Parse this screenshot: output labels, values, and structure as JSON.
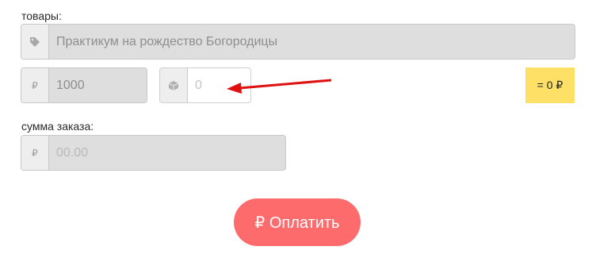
{
  "form": {
    "goods_label": "товары:",
    "product_value": "Практикум на рождество Богородицы",
    "price_icon": "₽",
    "price_value": "1000",
    "quantity_placeholder": "0",
    "total_text": "= 0 ₽",
    "order_sum_label": "сумма заказа:",
    "sum_icon": "₽",
    "sum_placeholder": "00.00",
    "pay_button_label": "₽ Оплатить"
  },
  "icons": {
    "product": "tag-icon",
    "price": "ruble-icon",
    "quantity": "box-icon",
    "sum": "ruble-icon"
  },
  "colors": {
    "pay_button": "#fd6b6d",
    "total_badge": "#ffe066",
    "arrow": "#e01010"
  }
}
